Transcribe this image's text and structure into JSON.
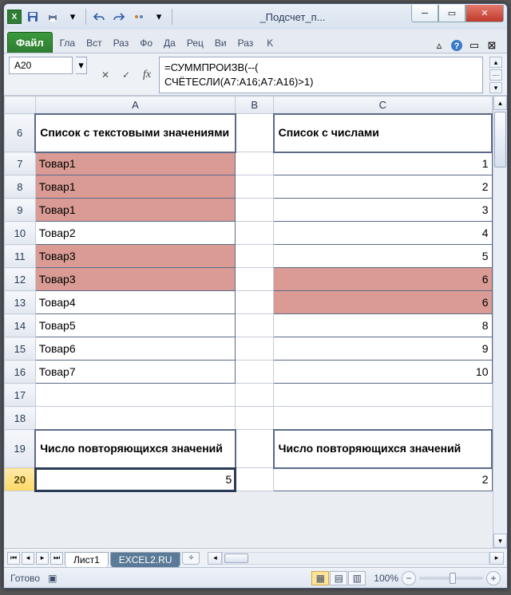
{
  "title": "_Подсчет_п...",
  "qat": {
    "save": "save",
    "undo": "undo",
    "redo": "redo"
  },
  "ribbon": {
    "file": "Файл",
    "tabs": [
      "Гла",
      "Вст",
      "Раз",
      "Фо",
      "Да",
      "Рец",
      "Ви",
      "Раз",
      "K"
    ]
  },
  "formula_bar": {
    "name_box": "A20",
    "formula_line1": "=СУММПРОИЗВ(--(",
    "formula_line2": "СЧЁТЕСЛИ(A7:A16;A7:A16)>1)"
  },
  "columns": [
    "A",
    "B",
    "C"
  ],
  "rows": {
    "r6": {
      "num": "6",
      "A_hdr": "Список с текстовыми значениями",
      "C_hdr": "Список с числами"
    },
    "r7": {
      "num": "7",
      "A": "Товар1",
      "Ahl": true,
      "C": "1"
    },
    "r8": {
      "num": "8",
      "A": "Товар1",
      "Ahl": true,
      "C": "2"
    },
    "r9": {
      "num": "9",
      "A": "Товар1",
      "Ahl": true,
      "C": "3"
    },
    "r10": {
      "num": "10",
      "A": "Товар2",
      "C": "4"
    },
    "r11": {
      "num": "11",
      "A": "Товар3",
      "Ahl": true,
      "C": "5"
    },
    "r12": {
      "num": "12",
      "A": "Товар3",
      "Ahl": true,
      "C": "6",
      "Chl": true
    },
    "r13": {
      "num": "13",
      "A": "Товар4",
      "C": "6",
      "Chl": true
    },
    "r14": {
      "num": "14",
      "A": "Товар5",
      "C": "8"
    },
    "r15": {
      "num": "15",
      "A": "Товар6",
      "C": "9"
    },
    "r16": {
      "num": "16",
      "A": "Товар7",
      "C": "10"
    },
    "r17": {
      "num": "17"
    },
    "r18": {
      "num": "18"
    },
    "r19": {
      "num": "19",
      "A_hdr": "Число повторяющихся значений",
      "C_hdr": "Число повторяющихся значений"
    },
    "r20": {
      "num": "20",
      "A_val": "5",
      "C_val": "2"
    }
  },
  "sheets": {
    "active": "Лист1",
    "inactive": "EXCEL2.RU"
  },
  "status": {
    "ready": "Готово",
    "zoom": "100%"
  }
}
